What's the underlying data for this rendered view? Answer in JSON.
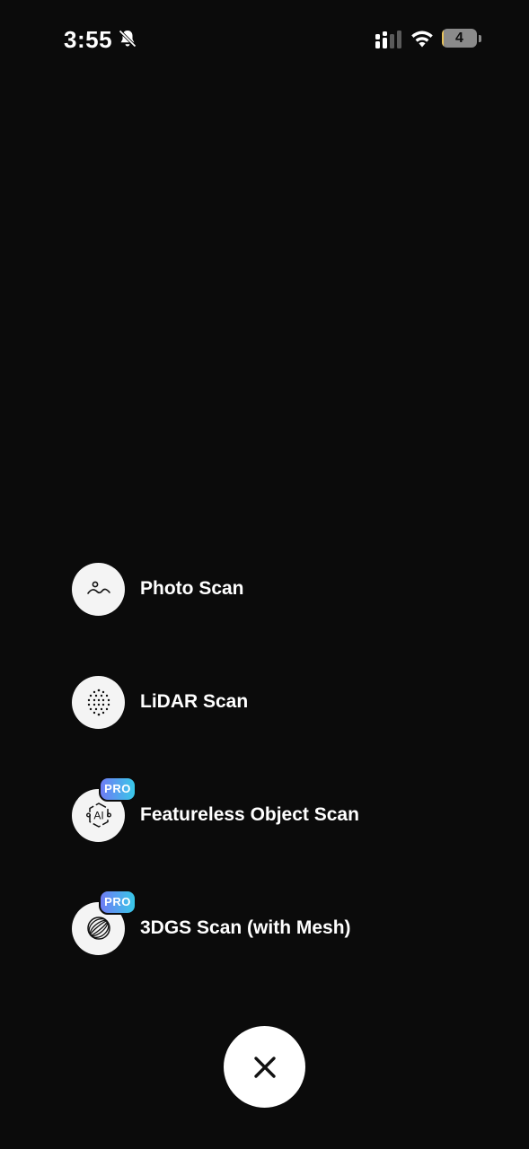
{
  "status_bar": {
    "time": "3:55",
    "battery_level": "4",
    "battery_fill_fraction": 0.04,
    "icons": [
      "bell-slash-icon",
      "signal-icon",
      "wifi-icon",
      "battery-icon"
    ]
  },
  "menu": {
    "items": [
      {
        "label": "Photo Scan",
        "icon": "photo-scan-icon",
        "pro": false
      },
      {
        "label": "LiDAR Scan",
        "icon": "lidar-scan-icon",
        "pro": false
      },
      {
        "label": "Featureless Object Scan",
        "icon": "ai-scan-icon",
        "pro": true,
        "badge": "PRO"
      },
      {
        "label": "3DGS Scan (with Mesh)",
        "icon": "sphere-scan-icon",
        "pro": true,
        "badge": "PRO"
      }
    ]
  },
  "close_button": {
    "icon": "close-icon"
  },
  "colors": {
    "background": "#0b0b0b",
    "icon_circle": "#f4f4f4",
    "pro_gradient_start": "#6f7cf5",
    "pro_gradient_end": "#38c8e8",
    "battery_low": "#e7c25a"
  }
}
